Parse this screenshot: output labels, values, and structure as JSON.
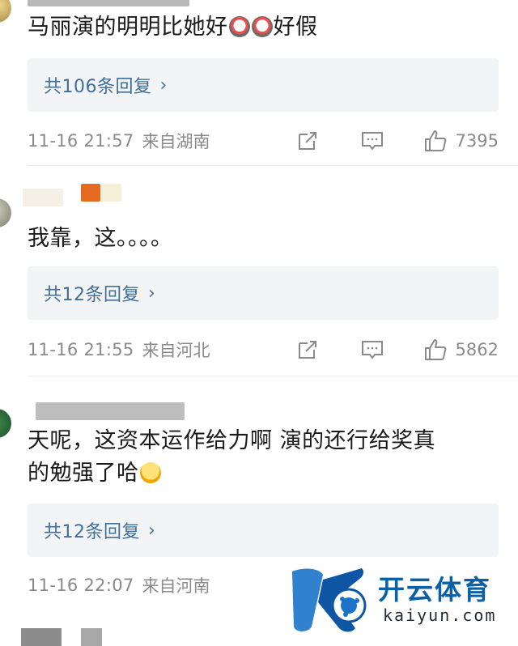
{
  "comments": [
    {
      "text_before_emoji": "马丽演的明明比她好",
      "text_after_emoji": "好假",
      "replies_label": "共106条回复",
      "time": "11-16 21:57",
      "location": "来自湖南",
      "likes": "7395"
    },
    {
      "text": "我靠，这。。。。",
      "replies_label": "共12条回复",
      "time": "11-16 21:55",
      "location": "来自河北",
      "likes": "5862"
    },
    {
      "text_line1": "天呢，这资本运作给力啊 演的还行给奖真",
      "text_line2": "的勉强了哈",
      "replies_label": "共12条回复",
      "time": "11-16 22:07",
      "location": "来自河南"
    }
  ],
  "watermark": {
    "cn": "开云体育",
    "en": "kaiyun.com"
  },
  "colors": {
    "reply_link": "#3f6f9a",
    "reply_bg": "#f3f4f6",
    "meta_text": "#8a8a8a",
    "watermark_blue": "#0b61a8"
  },
  "icons": {
    "share": "share-icon",
    "comment": "comment-icon",
    "like": "thumbs-up-icon",
    "chevron": "chevron-right-icon"
  }
}
